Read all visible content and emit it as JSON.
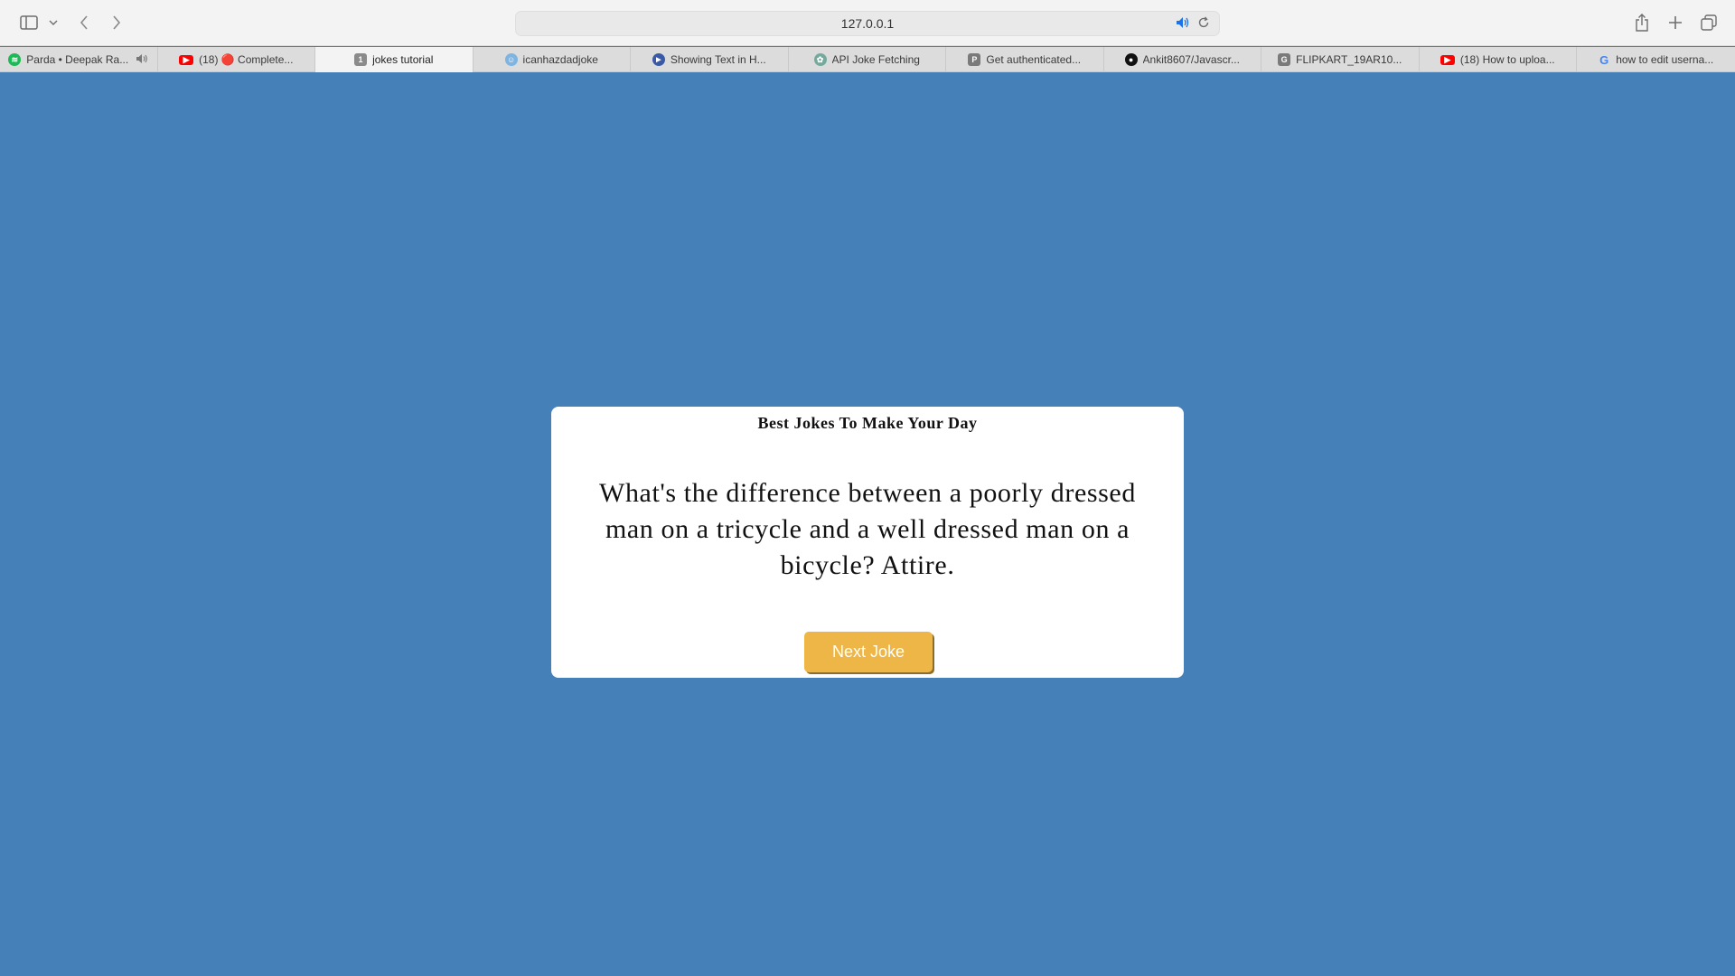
{
  "browser": {
    "address": "127.0.0.1",
    "tabs": [
      {
        "label": "Parda • Deepak Ra...",
        "icon": "spotify-icon",
        "color": "#1db954"
      },
      {
        "label": "(18) 🔴 Complete...",
        "icon": "youtube-icon",
        "color": "#ff0000"
      },
      {
        "label": "jokes tutorial",
        "icon": "number-one-icon",
        "color": "#8a8a8a",
        "active": true
      },
      {
        "label": "icanhazdadjoke",
        "icon": "dadjoke-icon",
        "color": "#7fb3e0"
      },
      {
        "label": "Showing Text in H...",
        "icon": "play-circle-icon",
        "color": "#3a5aa8"
      },
      {
        "label": "API Joke Fetching",
        "icon": "openai-icon",
        "color": "#74aa9c"
      },
      {
        "label": "Get authenticated...",
        "icon": "letter-p-icon",
        "color": "#7a7a7a"
      },
      {
        "label": "Ankit8607/Javascr...",
        "icon": "github-icon",
        "color": "#111111"
      },
      {
        "label": "FLIPKART_19AR10...",
        "icon": "letter-g-icon",
        "color": "#7a7a7a"
      },
      {
        "label": "(18) How to uploa...",
        "icon": "youtube-icon",
        "color": "#ff0000"
      },
      {
        "label": "how to edit userna...",
        "icon": "google-icon",
        "color": "#4285f4"
      }
    ]
  },
  "page": {
    "background_color": "#4680b8",
    "title": "Best Jokes To Make Your Day",
    "joke": "What's the difference between a poorly dressed man on a tricycle and a well dressed man on a bicycle? Attire.",
    "button_label": "Next Joke",
    "button_color": "#eeb646"
  }
}
